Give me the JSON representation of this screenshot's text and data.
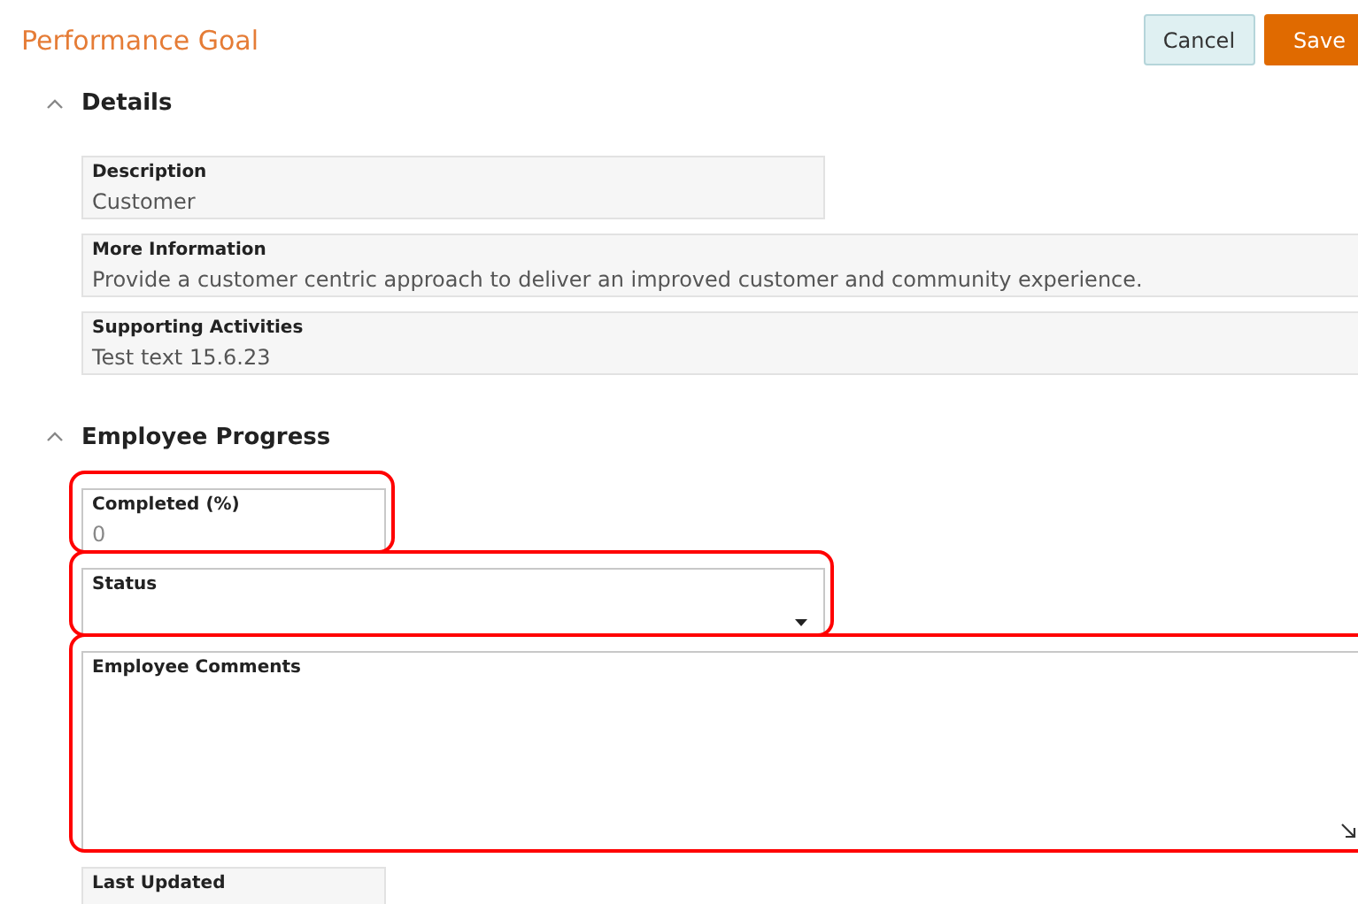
{
  "header": {
    "title": "Performance Goal",
    "buttons": [
      {
        "label": "Cancel",
        "kind": "secondary"
      },
      {
        "label": "Save",
        "kind": "primary"
      }
    ]
  },
  "sections": [
    {
      "title": "Details",
      "expanded": true,
      "fields": [
        {
          "label": "Description",
          "value": "Customer",
          "kind": "readonly",
          "highlighted": false
        },
        {
          "label": "More Information",
          "value": "Provide a customer centric approach to deliver an improved customer and community experience.",
          "kind": "readonly",
          "highlighted": false
        },
        {
          "label": "Supporting Activities",
          "value": "Test text 15.6.23",
          "kind": "readonly",
          "highlighted": false
        }
      ]
    },
    {
      "title": "Employee Progress",
      "expanded": true,
      "fields": [
        {
          "label": "Completed (%)",
          "placeholder": "0",
          "kind": "input",
          "highlighted": true
        },
        {
          "label": "Status",
          "kind": "select",
          "highlighted": true
        },
        {
          "label": "Employee Comments",
          "kind": "textarea",
          "highlighted": true
        },
        {
          "label": "Last Updated",
          "kind": "readonly",
          "highlighted": false
        }
      ]
    }
  ]
}
